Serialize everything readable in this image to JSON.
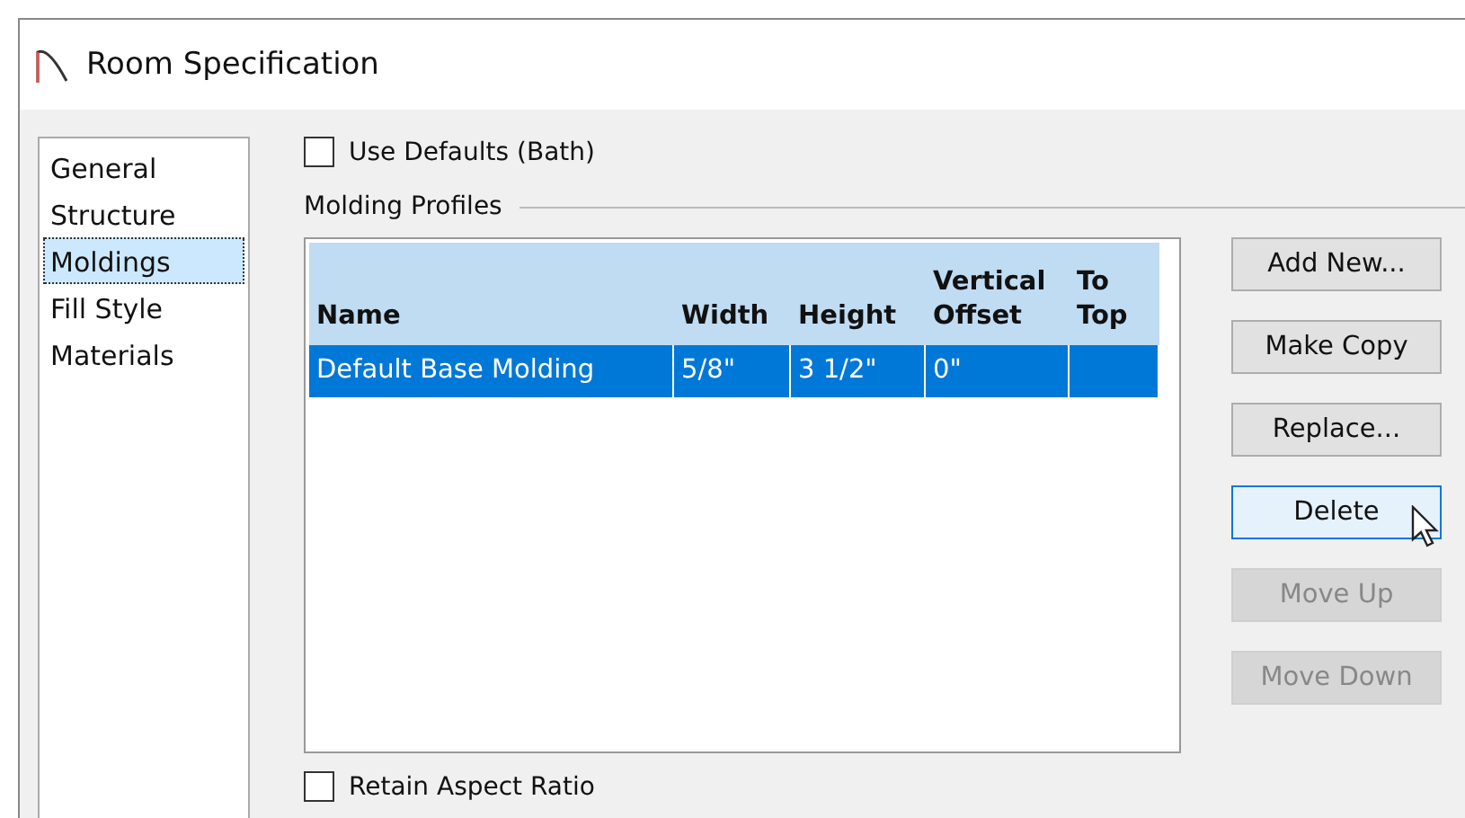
{
  "window": {
    "title": "Room Specification"
  },
  "sidebar": {
    "items": [
      {
        "label": "General",
        "selected": false
      },
      {
        "label": "Structure",
        "selected": false
      },
      {
        "label": "Moldings",
        "selected": true
      },
      {
        "label": "Fill Style",
        "selected": false
      },
      {
        "label": "Materials",
        "selected": false
      }
    ]
  },
  "use_defaults": {
    "label": "Use Defaults (Bath)",
    "checked": false
  },
  "group": {
    "title": "Molding Profiles"
  },
  "table": {
    "columns": [
      {
        "label": "Name"
      },
      {
        "label": "Width"
      },
      {
        "label": "Height"
      },
      {
        "label": "Vertical Offset"
      },
      {
        "label": "To Top"
      }
    ],
    "rows": [
      {
        "cells": [
          "Default Base Molding",
          "5/8\"",
          "3 1/2\"",
          "0\"",
          ""
        ],
        "selected": true
      }
    ]
  },
  "buttons": [
    {
      "label": "Add New...",
      "disabled": false,
      "hovered": false
    },
    {
      "label": "Make Copy",
      "disabled": false,
      "hovered": false
    },
    {
      "label": "Replace...",
      "disabled": false,
      "hovered": false
    },
    {
      "label": "Delete",
      "disabled": false,
      "hovered": true
    },
    {
      "label": "Move Up",
      "disabled": true,
      "hovered": false
    },
    {
      "label": "Move Down",
      "disabled": true,
      "hovered": false
    }
  ],
  "retain_aspect": {
    "label": "Retain Aspect Ratio",
    "checked": false
  }
}
